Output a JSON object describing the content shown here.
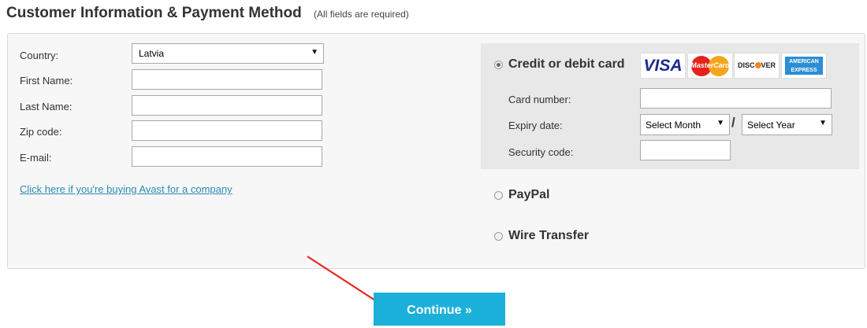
{
  "header": {
    "title": "Customer Information & Payment Method",
    "note": "(All fields are required)"
  },
  "customer": {
    "country_label": "Country:",
    "country_value": "Latvia",
    "first_name_label": "First Name:",
    "last_name_label": "Last Name:",
    "zip_label": "Zip code:",
    "email_label": "E-mail:",
    "company_link": "Click here if you're buying Avast for a company"
  },
  "payment": {
    "credit_label": "Credit or debit card",
    "card_number_label": "Card number:",
    "expiry_label": "Expiry date:",
    "expiry_separator": "/",
    "month_select": "Select Month",
    "year_select": "Select Year",
    "security_label": "Security code:",
    "paypal_label": "PayPal",
    "wire_label": "Wire Transfer",
    "selected_method": "credit"
  },
  "card_logos": {
    "visa": "VISA",
    "mastercard": "MasterCard",
    "discover_pre": "DISC",
    "discover_post": "VER",
    "amex_line1": "AMERICAN",
    "amex_line2": "EXPRESS"
  },
  "actions": {
    "continue_label": "Continue »"
  },
  "colors": {
    "accent": "#1ab0d9",
    "link": "#2a8bb5",
    "arrow": "#e8251f",
    "card_panel": "#e8e8e8"
  },
  "icons": {
    "dropdown": "chevron-down-icon",
    "arrow": "red-pointer-arrow"
  }
}
